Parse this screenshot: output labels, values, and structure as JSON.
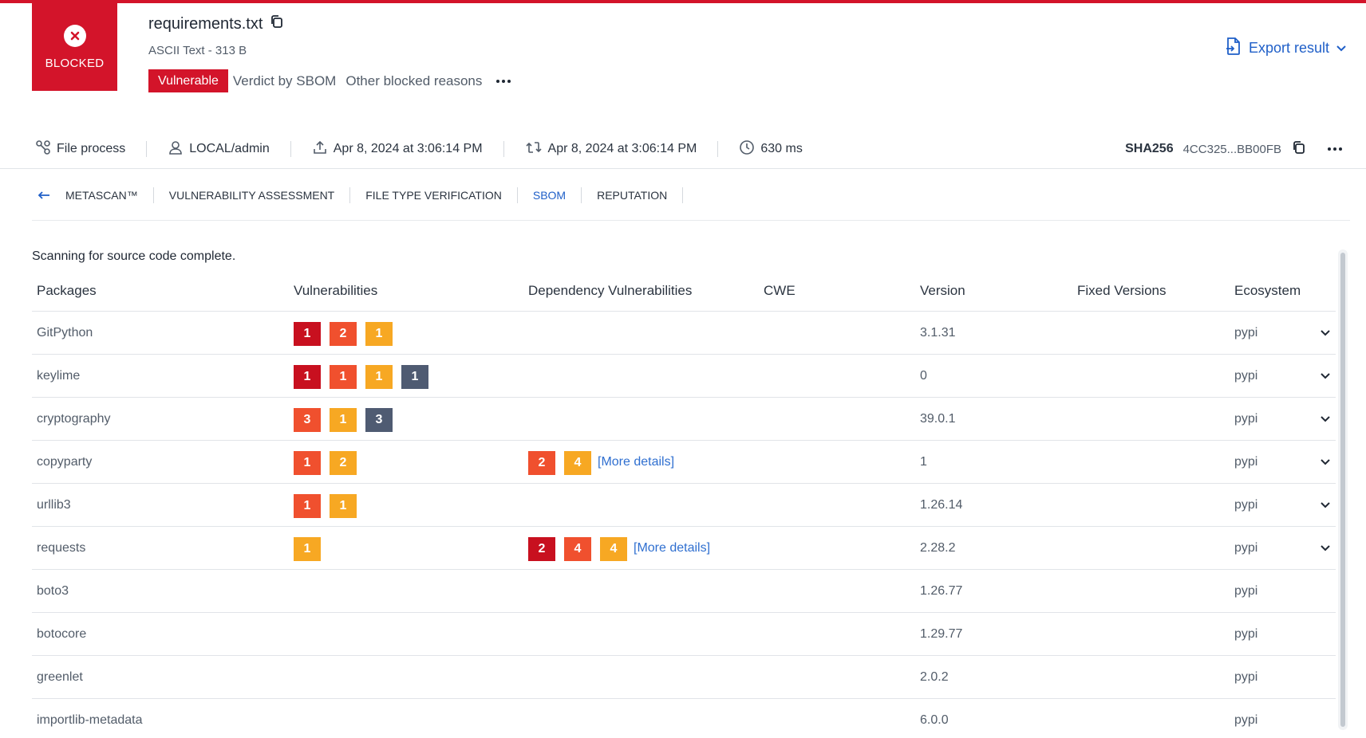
{
  "verdict": {
    "label": "BLOCKED",
    "color": "#d3142a"
  },
  "file": {
    "name": "requirements.txt",
    "type": "ASCII Text - 313 B",
    "tag": "Vulnerable",
    "verdict_by": "Verdict by SBOM",
    "other": "Other blocked reasons"
  },
  "export_label": "Export result",
  "meta": {
    "process": "File process",
    "user": "LOCAL/admin",
    "uploaded": "Apr 8, 2024 at 3:06:14 PM",
    "processed": "Apr 8, 2024 at 3:06:14 PM",
    "duration": "630 ms",
    "sha_label": "SHA256",
    "sha_value": "4CC325...BB00FB"
  },
  "tabs": [
    "METASCAN™",
    "VULNERABILITY ASSESSMENT",
    "FILE TYPE VERIFICATION",
    "SBOM",
    "REPUTATION"
  ],
  "active_tab": "SBOM",
  "scan_message": "Scanning for source code complete.",
  "severity_colors": {
    "critical": "#c8101f",
    "high": "#f0502e",
    "medium": "#f7a823",
    "unknown": "#4f5b72"
  },
  "link_color": "#2f6fd0",
  "columns": [
    "Packages",
    "Vulnerabilities",
    "Dependency Vulnerabilities",
    "CWE",
    "Version",
    "Fixed Versions",
    "Ecosystem"
  ],
  "rows": [
    {
      "package": "GitPython",
      "vulns": [
        {
          "sev": "critical",
          "count": "1"
        },
        {
          "sev": "high",
          "count": "2"
        },
        {
          "sev": "medium",
          "count": "1"
        }
      ],
      "dep": [],
      "dep_link": "",
      "cwe": "",
      "version": "3.1.31",
      "fixed": "",
      "ecosystem": "pypi",
      "expandable": true
    },
    {
      "package": "keylime",
      "vulns": [
        {
          "sev": "critical",
          "count": "1"
        },
        {
          "sev": "high",
          "count": "1"
        },
        {
          "sev": "medium",
          "count": "1"
        },
        {
          "sev": "unknown",
          "count": "1"
        }
      ],
      "dep": [],
      "dep_link": "",
      "cwe": "",
      "version": "0",
      "fixed": "",
      "ecosystem": "pypi",
      "expandable": true
    },
    {
      "package": "cryptography",
      "vulns": [
        {
          "sev": "high",
          "count": "3"
        },
        {
          "sev": "medium",
          "count": "1"
        },
        {
          "sev": "unknown",
          "count": "3"
        }
      ],
      "dep": [],
      "dep_link": "",
      "cwe": "",
      "version": "39.0.1",
      "fixed": "",
      "ecosystem": "pypi",
      "expandable": true
    },
    {
      "package": "copyparty",
      "vulns": [
        {
          "sev": "high",
          "count": "1"
        },
        {
          "sev": "medium",
          "count": "2"
        }
      ],
      "dep": [
        {
          "sev": "high",
          "count": "2"
        },
        {
          "sev": "medium",
          "count": "4"
        }
      ],
      "dep_link": "[More details]",
      "cwe": "",
      "version": "1",
      "fixed": "",
      "ecosystem": "pypi",
      "expandable": true
    },
    {
      "package": "urllib3",
      "vulns": [
        {
          "sev": "high",
          "count": "1"
        },
        {
          "sev": "medium",
          "count": "1"
        }
      ],
      "dep": [],
      "dep_link": "",
      "cwe": "",
      "version": "1.26.14",
      "fixed": "",
      "ecosystem": "pypi",
      "expandable": true
    },
    {
      "package": "requests",
      "vulns": [
        {
          "sev": "medium",
          "count": "1"
        }
      ],
      "dep": [
        {
          "sev": "critical",
          "count": "2"
        },
        {
          "sev": "high",
          "count": "4"
        },
        {
          "sev": "medium",
          "count": "4"
        }
      ],
      "dep_link": "[More details]",
      "cwe": "",
      "version": "2.28.2",
      "fixed": "",
      "ecosystem": "pypi",
      "expandable": true
    },
    {
      "package": "boto3",
      "vulns": [],
      "dep": [],
      "dep_link": "",
      "cwe": "",
      "version": "1.26.77",
      "fixed": "",
      "ecosystem": "pypi",
      "expandable": false
    },
    {
      "package": "botocore",
      "vulns": [],
      "dep": [],
      "dep_link": "",
      "cwe": "",
      "version": "1.29.77",
      "fixed": "",
      "ecosystem": "pypi",
      "expandable": false
    },
    {
      "package": "greenlet",
      "vulns": [],
      "dep": [],
      "dep_link": "",
      "cwe": "",
      "version": "2.0.2",
      "fixed": "",
      "ecosystem": "pypi",
      "expandable": false
    },
    {
      "package": "importlib-metadata",
      "vulns": [],
      "dep": [],
      "dep_link": "",
      "cwe": "",
      "version": "6.0.0",
      "fixed": "",
      "ecosystem": "pypi",
      "expandable": false
    }
  ]
}
